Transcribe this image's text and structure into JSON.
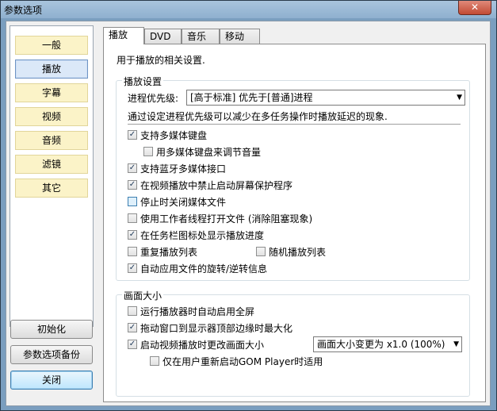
{
  "window": {
    "title": "参数选项",
    "close_symbol": "✕"
  },
  "sidebar": {
    "items": [
      {
        "label": "一般"
      },
      {
        "label": "播放",
        "active": true
      },
      {
        "label": "字幕"
      },
      {
        "label": "视频"
      },
      {
        "label": "音频"
      },
      {
        "label": "滤镜"
      },
      {
        "label": "其它"
      }
    ]
  },
  "bottom_buttons": {
    "reset": "初始化",
    "backup": "参数选项备份",
    "close": "关闭"
  },
  "tabs": [
    "播放",
    "DVD",
    "音乐",
    "移动"
  ],
  "panel": {
    "description": "用于播放的相关设置.",
    "playback_group": {
      "title": "播放设置",
      "priority_label": "进程优先级:",
      "priority_value": "[高于标准] 优先于[普通]进程",
      "priority_hint": "通过设定进程优先级可以减少在多任务操作时播放延迟的现象.",
      "options": {
        "multimedia_keyboard": {
          "label": "支持多媒体键盘",
          "checked": true
        },
        "mm_keyboard_volume": {
          "label": "用多媒体键盘来调节音量",
          "checked": false
        },
        "bluetooth_interface": {
          "label": "支持蓝牙多媒体接口",
          "checked": true
        },
        "block_screensaver": {
          "label": "在视频播放中禁止启动屏幕保护程序",
          "checked": true
        },
        "close_on_stop": {
          "label": "停止时关闭媒体文件",
          "checked": false
        },
        "worker_thread": {
          "label": "使用工作者线程打开文件 (消除阻塞现象)",
          "checked": false
        },
        "taskbar_progress": {
          "label": "在任务栏图标处显示播放进度",
          "checked": true
        },
        "repeat_playlist": {
          "label": "重复播放列表",
          "checked": false
        },
        "random_playlist": {
          "label": "随机播放列表",
          "checked": false
        },
        "auto_rotate": {
          "label": "自动应用文件的旋转/逆转信息",
          "checked": true
        }
      }
    },
    "screen_group": {
      "title": "画面大小",
      "options": {
        "auto_fullscreen": {
          "label": "运行播放器时自动启用全屏",
          "checked": false
        },
        "drag_maximize": {
          "label": "拖动窗口到显示器顶部边缘时最大化",
          "checked": true
        },
        "change_size_on_start": {
          "label": "启动视频播放时更改画面大小",
          "checked": true
        },
        "only_on_restart": {
          "label": "仅在用户重新启动GOM Player时适用",
          "checked": false
        }
      },
      "size_dropdown": "画面大小变更为 x1.0 (100%)"
    }
  },
  "icons": {
    "check": "✓",
    "dropdown_arrow": "▼"
  }
}
